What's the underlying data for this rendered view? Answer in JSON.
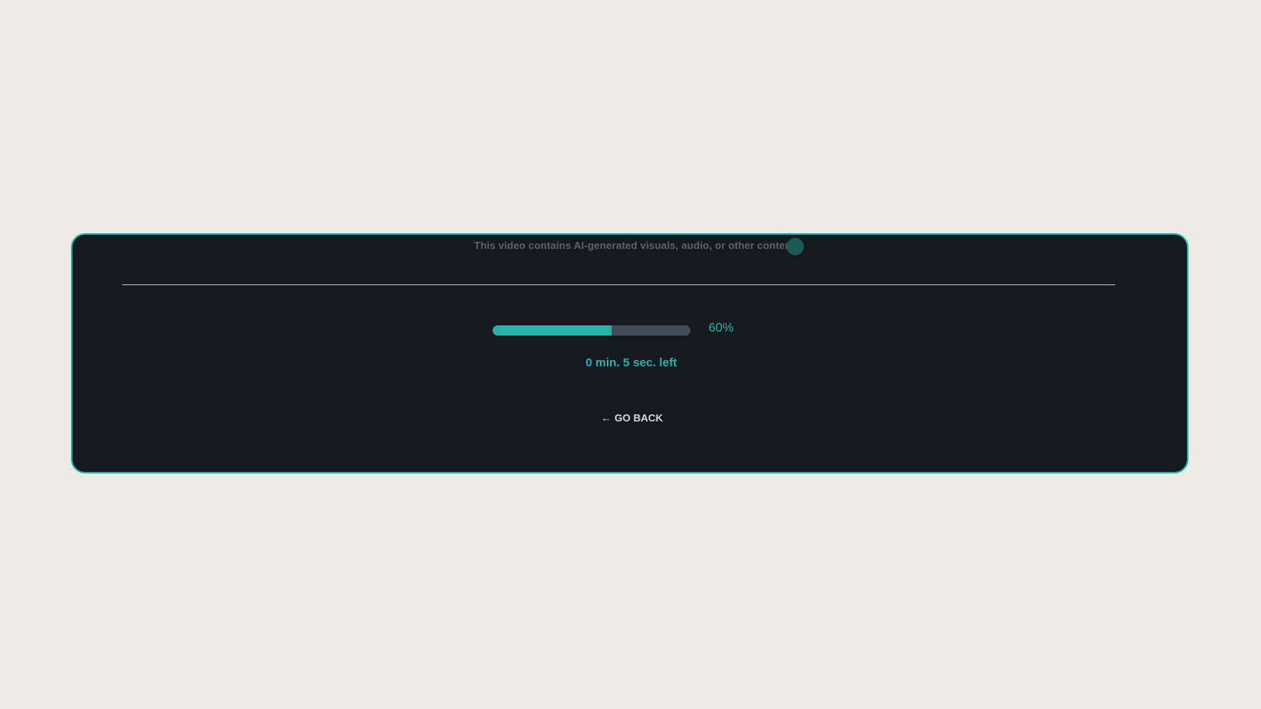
{
  "notice": {
    "text": "This video contains AI-generated visuals, audio, or other content"
  },
  "progress": {
    "value": 60,
    "label": "60%",
    "time_left": "0 min. 5 sec. left"
  },
  "actions": {
    "go_back_icon": "←",
    "go_back_label": "GO BACK"
  },
  "colors": {
    "page_background": "#ecece4",
    "panel_background": "#151a21",
    "accent": "#26b3a8",
    "track": "#414b59"
  },
  "icons": {
    "go_back": "arrow-left-icon",
    "cursor": "cursor-dot-icon"
  }
}
